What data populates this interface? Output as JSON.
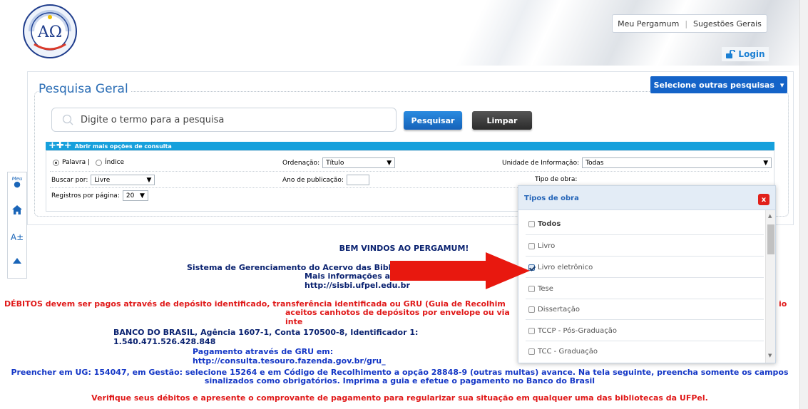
{
  "header": {
    "topnav": {
      "meu_pergamum": "Meu Pergamum",
      "separator": "|",
      "sugestoes": "Sugestões Gerais"
    },
    "login": "Login"
  },
  "search": {
    "title": "Pesquisa Geral",
    "outras": "Selecione outras pesquisas",
    "placeholder": "Digite o termo para a pesquisa",
    "btn_pesquisar": "Pesquisar",
    "btn_limpar": "Limpar",
    "more_options": "Abrir mais opções de consulta",
    "options": {
      "palavra": "Palavra |",
      "indice": "Índice",
      "ordenacao_label": "Ordenação:",
      "ordenacao_value": "Título",
      "unidade_label": "Unidade de Informação:",
      "unidade_value": "Todas",
      "buscar_label": "Buscar por:",
      "buscar_value": "Livre",
      "ano_label": "Ano de publicação:",
      "tipo_label": "Tipo de obra:",
      "registros_label": "Registros por página:",
      "registros_value": "20"
    }
  },
  "sidebar": {
    "meu_label": "Meu"
  },
  "content": {
    "welcome": "BEM VINDOS AO PERGAMUM!",
    "sistema": "Sistema de Gerenciamento do Acervo das Bibliotec",
    "info": "Mais informações acesse: http://sisbi.ufpel.edu.br",
    "debitos_1": "DÉBITOS devem ser pagos através de depósito identificado, transferência identificada ou GRU (Guia de Recolhim",
    "debitos_1_end": "io",
    "debitos_2": "aceitos canhotos de depósitos por envelope ou via inte",
    "banco": "BANCO DO BRASIL, Agência 1607-1, Conta 170500-8, Identificador 1: 1.540.471.526.428.848",
    "gru": "Pagamento através de GRU em: http://consulta.tesouro.fazenda.gov.br/gru_",
    "preencher_1": "Preencher em UG: 154047, em Gestão: selecione 15264 e em Código de Recolhimento a opção 28848-9 (outras multas) avance. Na tela seguinte, preencha somente os campos",
    "preencher_2": "sinalizados como obrigatórios. Imprima a guia e efetue o pagamento no Banco do Brasil",
    "verifique": "Verifique seus débitos e apresente o comprovante de pagamento para regularizar sua situação em qualquer uma das bibliotecas da UFPel."
  },
  "popup": {
    "title": "Tipos de obra",
    "close": "x",
    "items": [
      {
        "label": "Todos",
        "checked": false
      },
      {
        "label": "Livro",
        "checked": false
      },
      {
        "label": "Livro eletrônico",
        "checked": true
      },
      {
        "label": "Tese",
        "checked": false
      },
      {
        "label": "Dissertação",
        "checked": false
      },
      {
        "label": "TCCP - Pós-Graduação",
        "checked": false
      },
      {
        "label": "TCC - Graduação",
        "checked": false
      }
    ]
  },
  "colors": {
    "accent": "#1463c8",
    "alert": "#e01919",
    "arrow": "#e8180f"
  }
}
